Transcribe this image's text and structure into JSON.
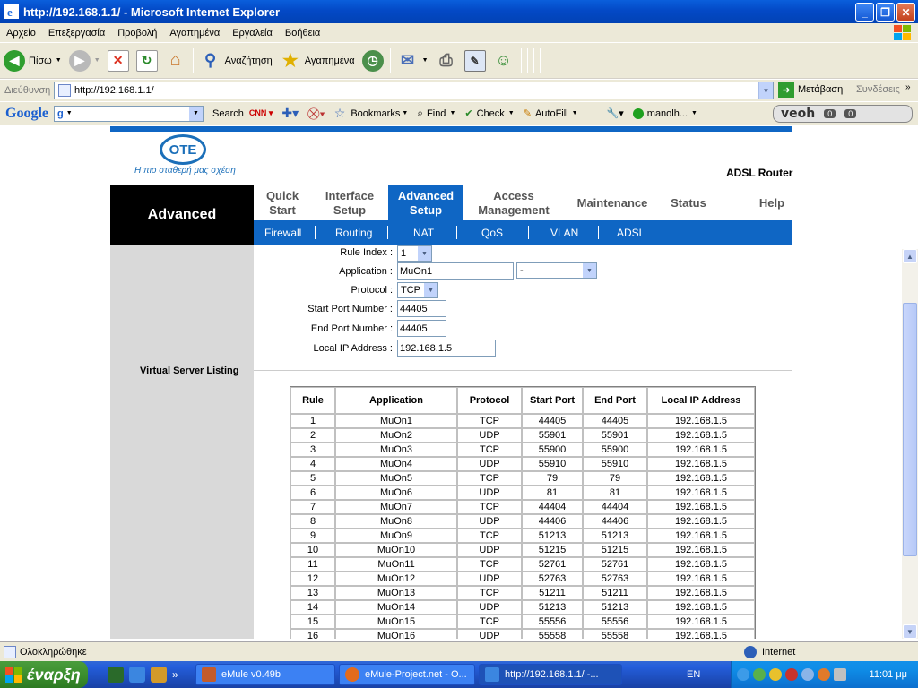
{
  "window": {
    "title": "http://192.168.1.1/ - Microsoft Internet Explorer"
  },
  "menu": [
    "Αρχείο",
    "Επεξεργασία",
    "Προβολή",
    "Αγαπημένα",
    "Εργαλεία",
    "Βοήθεια"
  ],
  "toolbar": {
    "back": "Πίσω",
    "search": "Αναζήτηση",
    "favorites": "Αγαπημένα"
  },
  "address": {
    "label": "Διεύθυνση",
    "url": "http://192.168.1.1/",
    "go": "Μετάβαση",
    "links": "Συνδέσεις"
  },
  "google_toolbar": {
    "logo": "Google",
    "search_value": "g",
    "search": "Search",
    "bookmarks": "Bookmarks",
    "find": "Find",
    "check": "Check",
    "autofill": "AutoFill",
    "user": "manolh...",
    "veoh": "veoh",
    "veoh_count1": "0",
    "veoh_count2": "0"
  },
  "router": {
    "logo": "ΟΤΕ",
    "slogan": "Η πιο σταθερή μας σχέση",
    "model": "ADSL Router",
    "section": "Advanced",
    "nav": [
      {
        "label1": "Quick",
        "label2": "Start"
      },
      {
        "label1": "Interface",
        "label2": "Setup"
      },
      {
        "label1": "Advanced",
        "label2": "Setup"
      },
      {
        "label1": "Access",
        "label2": "Management"
      },
      {
        "label1": "Maintenance",
        "label2": ""
      },
      {
        "label1": "Status",
        "label2": ""
      },
      {
        "label1": "Help",
        "label2": ""
      }
    ],
    "subnav": [
      "Firewall",
      "Routing",
      "NAT",
      "QoS",
      "VLAN",
      "ADSL"
    ],
    "form": {
      "rule_index_label": "Rule Index :",
      "rule_index": "1",
      "application_label": "Application :",
      "application": "MuOn1",
      "application_preset": "-",
      "protocol_label": "Protocol :",
      "protocol": "TCP",
      "start_port_label": "Start Port Number :",
      "start_port": "44405",
      "end_port_label": "End Port Number :",
      "end_port": "44405",
      "local_ip_label": "Local IP Address :",
      "local_ip": "192.168.1.5"
    },
    "listing_label": "Virtual Server Listing",
    "table": {
      "headers": [
        "Rule",
        "Application",
        "Protocol",
        "Start Port",
        "End Port",
        "Local IP Address"
      ],
      "rows": [
        [
          "1",
          "MuOn1",
          "TCP",
          "44405",
          "44405",
          "192.168.1.5"
        ],
        [
          "2",
          "MuOn2",
          "UDP",
          "55901",
          "55901",
          "192.168.1.5"
        ],
        [
          "3",
          "MuOn3",
          "TCP",
          "55900",
          "55900",
          "192.168.1.5"
        ],
        [
          "4",
          "MuOn4",
          "UDP",
          "55910",
          "55910",
          "192.168.1.5"
        ],
        [
          "5",
          "MuOn5",
          "TCP",
          "79",
          "79",
          "192.168.1.5"
        ],
        [
          "6",
          "MuOn6",
          "UDP",
          "81",
          "81",
          "192.168.1.5"
        ],
        [
          "7",
          "MuOn7",
          "TCP",
          "44404",
          "44404",
          "192.168.1.5"
        ],
        [
          "8",
          "MuOn8",
          "UDP",
          "44406",
          "44406",
          "192.168.1.5"
        ],
        [
          "9",
          "MuOn9",
          "TCP",
          "51213",
          "51213",
          "192.168.1.5"
        ],
        [
          "10",
          "MuOn10",
          "UDP",
          "51215",
          "51215",
          "192.168.1.5"
        ],
        [
          "11",
          "MuOn11",
          "TCP",
          "52761",
          "52761",
          "192.168.1.5"
        ],
        [
          "12",
          "MuOn12",
          "UDP",
          "52763",
          "52763",
          "192.168.1.5"
        ],
        [
          "13",
          "MuOn13",
          "TCP",
          "51211",
          "51211",
          "192.168.1.5"
        ],
        [
          "14",
          "MuOn14",
          "UDP",
          "51213",
          "51213",
          "192.168.1.5"
        ],
        [
          "15",
          "MuOn15",
          "TCP",
          "55556",
          "55556",
          "192.168.1.5"
        ],
        [
          "16",
          "MuOn16",
          "UDP",
          "55558",
          "55558",
          "192.168.1.5"
        ]
      ]
    }
  },
  "status": {
    "text": "Ολοκληρώθηκε",
    "zone": "Internet"
  },
  "taskbar": {
    "start": "έναρξη",
    "tasks": [
      "eMule v0.49b",
      "eMule-Project.net - O...",
      "http://192.168.1.1/ -..."
    ],
    "lang": "EN",
    "clock": "11:01 μμ"
  },
  "colors": {
    "router_blue": "#0f66c4",
    "xp_blue": "#0349c6",
    "start_green": "#3c8f2e"
  }
}
